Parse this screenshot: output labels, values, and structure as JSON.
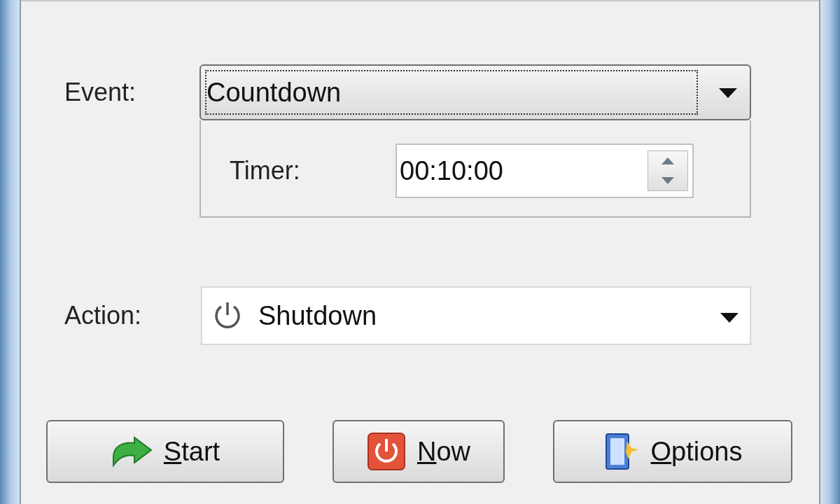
{
  "event": {
    "label": "Event:",
    "value": "Countdown",
    "focused": true
  },
  "timer": {
    "label": "Timer:",
    "value": "00:10:00"
  },
  "action": {
    "label": "Action:",
    "value": "Shutdown"
  },
  "buttons": [
    {
      "kind": "start",
      "label": "Start"
    },
    {
      "kind": "now",
      "label": "Now"
    },
    {
      "kind": "options",
      "label": "Options"
    }
  ]
}
